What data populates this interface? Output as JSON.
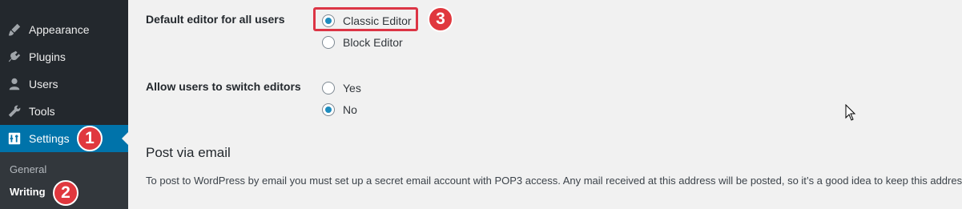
{
  "sidebar": {
    "items": [
      {
        "label": "Appearance",
        "icon": "paintbrush-icon"
      },
      {
        "label": "Plugins",
        "icon": "plug-icon"
      },
      {
        "label": "Users",
        "icon": "user-icon"
      },
      {
        "label": "Tools",
        "icon": "wrench-icon"
      },
      {
        "label": "Settings",
        "icon": "settings-icon",
        "active": true
      }
    ],
    "submenu": [
      {
        "label": "General"
      },
      {
        "label": "Writing",
        "current": true
      }
    ]
  },
  "annotations": {
    "badge1": "1",
    "badge2": "2",
    "badge3": "3",
    "badge_color": "#e0383e"
  },
  "settings": {
    "default_editor": {
      "label": "Default editor for all users",
      "options": [
        {
          "label": "Classic Editor",
          "checked": true
        },
        {
          "label": "Block Editor",
          "checked": false
        }
      ]
    },
    "allow_switch": {
      "label": "Allow users to switch editors",
      "options": [
        {
          "label": "Yes",
          "checked": false
        },
        {
          "label": "No",
          "checked": true
        }
      ]
    }
  },
  "post_via_email": {
    "title": "Post via email",
    "description": "To post to WordPress by email you must set up a secret email account with POP3 access. Any mail received at this address will be posted, so it’s a good idea to keep this address v"
  },
  "colors": {
    "sidebar_bg": "#23282d",
    "active_bg": "#0073aa",
    "radio_dot": "#1e8cbe",
    "highlight": "#dc3545"
  }
}
